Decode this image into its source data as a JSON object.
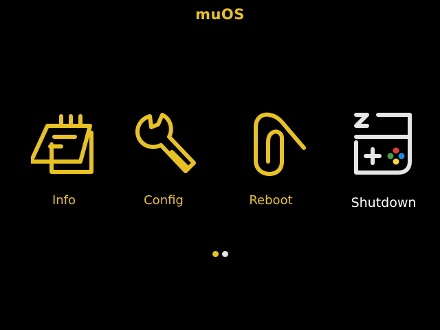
{
  "header": {
    "title": "muOS"
  },
  "menu": {
    "items": [
      {
        "label": "Info",
        "icon": "notepad-icon",
        "selected": false
      },
      {
        "label": "Config",
        "icon": "wrench-icon",
        "selected": false
      },
      {
        "label": "Reboot",
        "icon": "paperclip-icon",
        "selected": false
      },
      {
        "label": "Shutdown",
        "icon": "sleeping-gameboy-icon",
        "selected": true
      }
    ]
  },
  "pager": {
    "pages": 2,
    "current": 1
  },
  "colors": {
    "background": "#000000",
    "accent": "#e8c21f",
    "selected": "#ffffff",
    "inactive_dot": "#e6e6e6",
    "gamepad_red": "#e53935",
    "gamepad_green": "#43a047",
    "gamepad_blue": "#1e88e5",
    "gamepad_yellow": "#fdd835"
  }
}
